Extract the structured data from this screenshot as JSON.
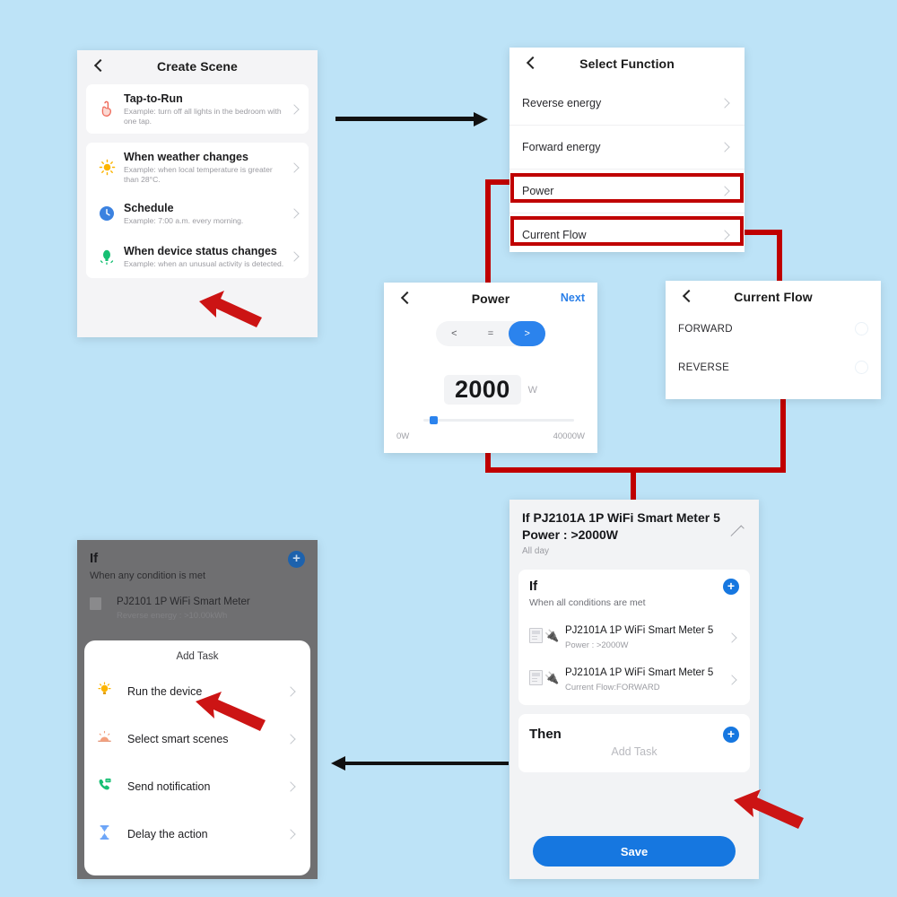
{
  "create_scene": {
    "title": "Create Scene",
    "back_icon": "back-chevron-icon",
    "items": [
      {
        "icon": "tap-hand-icon",
        "title": "Tap-to-Run",
        "subtitle": "Example: turn off all lights in the bedroom with one tap."
      },
      {
        "icon": "sun-icon",
        "title": "When weather changes",
        "subtitle": "Example: when local temperature is greater than 28°C."
      },
      {
        "icon": "clock-icon",
        "title": "Schedule",
        "subtitle": "Example: 7:00 a.m. every morning."
      },
      {
        "icon": "sensor-icon",
        "title": "When device status changes",
        "subtitle": "Example: when an unusual activity is detected."
      }
    ]
  },
  "select_function": {
    "title": "Select Function",
    "items": [
      {
        "label": "Reverse energy",
        "highlighted": false
      },
      {
        "label": "Forward energy",
        "highlighted": false
      },
      {
        "label": "Power",
        "highlighted": true
      },
      {
        "label": "Current Flow",
        "highlighted": true
      }
    ]
  },
  "power": {
    "title": "Power",
    "next_label": "Next",
    "operators": [
      "<",
      "=",
      ">"
    ],
    "selected_operator": ">",
    "value": "2000",
    "unit": "W",
    "min_label": "0W",
    "max_label": "40000W",
    "slider_percent": 5
  },
  "current_flow": {
    "title": "Current Flow",
    "options": [
      "FORWARD",
      "REVERSE"
    ]
  },
  "summary": {
    "header_title": "If PJ2101A 1P WiFi Smart Meter  5 Power : >2000W",
    "header_subtitle": "All day",
    "edit_icon": "pencil-icon",
    "if_section": {
      "heading": "If",
      "subheading": "When all conditions are met",
      "add_label": "+",
      "devices": [
        {
          "name": "PJ2101A 1P WiFi Smart Meter 5",
          "detail": "Power : >2000W"
        },
        {
          "name": "PJ2101A 1P WiFi Smart Meter 5",
          "detail": "Current Flow:FORWARD"
        }
      ]
    },
    "then_section": {
      "heading": "Then",
      "add_label": "+",
      "add_task_label": "Add Task"
    },
    "save_label": "Save"
  },
  "add_task": {
    "background": {
      "heading": "If",
      "subheading": "When any condition is met",
      "add_label": "+",
      "device_name": "PJ2101 1P WiFi Smart Meter",
      "device_detail": "Reverse energy : >10.00kWh"
    },
    "sheet_title": "Add Task",
    "items": [
      {
        "icon": "bulb-icon",
        "label": "Run the device"
      },
      {
        "icon": "scene-icon",
        "label": "Select smart scenes"
      },
      {
        "icon": "phone-notify-icon",
        "label": "Send notification"
      },
      {
        "icon": "hourglass-icon",
        "label": "Delay the action"
      }
    ]
  },
  "colors": {
    "background": "#bde3f7",
    "accent_blue": "#1677e0",
    "highlight_red": "#c00000",
    "arrow_black": "#111111"
  }
}
